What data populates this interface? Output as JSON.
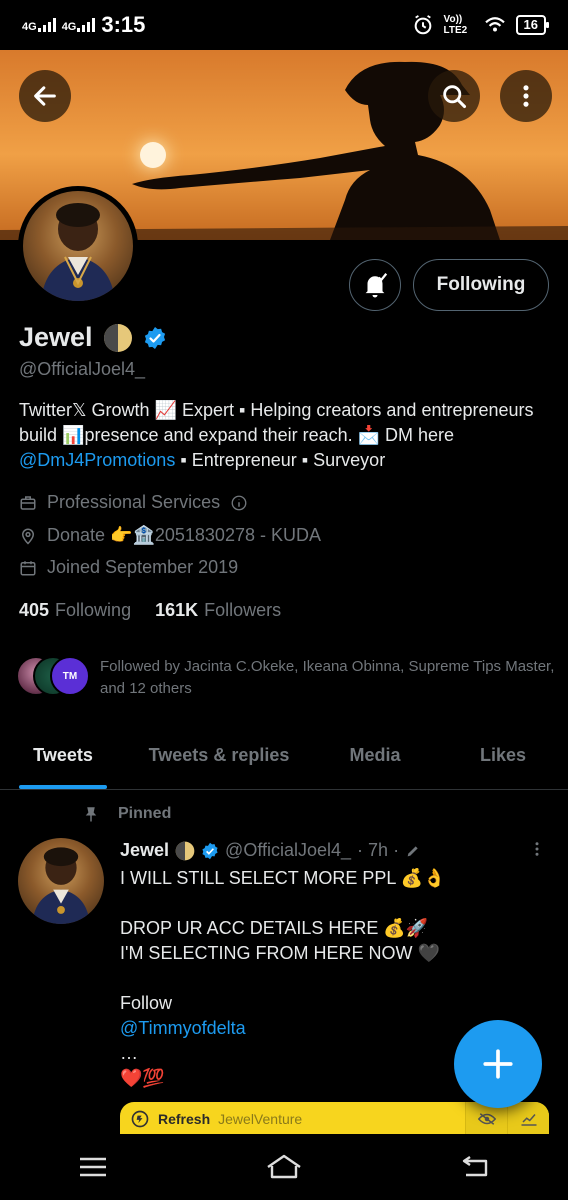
{
  "status_bar": {
    "network_1": "4G",
    "network_2": "4G",
    "time": "3:15",
    "volte_label": "Vo)) LTE2",
    "battery": "16"
  },
  "profile": {
    "display_name": "Jewel",
    "handle": "@OfficialJoel4_",
    "bio_part1": "Twitter𝕏 Growth 📈 Expert ▪ Helping creators and entrepreneurs build 📊presence and expand their reach. 📩 DM here ",
    "bio_link": "@DmJ4Promotions",
    "bio_part2": " ▪ Entrepreneur ▪ Surveyor",
    "category": "Professional Services",
    "location": "Donate 👉🏦2051830278 - KUDA",
    "joined": "Joined September 2019",
    "following_count": "405",
    "following_label": "Following",
    "followers_count": "161K",
    "followers_label": "Followers",
    "followed_by": "Followed by Jacinta C.Okeke, Ikeana Obinna, Supreme Tips Master, and 12 others",
    "following_button": "Following"
  },
  "tabs": [
    {
      "label": "Tweets",
      "active": true
    },
    {
      "label": "Tweets & replies",
      "active": false
    },
    {
      "label": "Media",
      "active": false
    },
    {
      "label": "Likes",
      "active": false
    }
  ],
  "pinned_tweet": {
    "pinned_label": "Pinned",
    "name": "Jewel",
    "handle": "@OfficialJoel4_",
    "time": "· 7h ·",
    "lines": [
      "I WILL STILL SELECT MORE PPL 💰👌",
      "",
      "DROP UR ACC DETAILS HERE 💰🚀",
      "I'M SELECTING FROM HERE NOW 🖤",
      "",
      "Follow"
    ],
    "mention": "@Timmyofdelta",
    "ellipsis": "…",
    "reaction": "❤️💯"
  },
  "ad_strip": {
    "refresh": "Refresh",
    "brand": "JewelVenture"
  },
  "colors": {
    "accent": "#1d9bf0",
    "secondary_text": "#71767b",
    "primary_text": "#e7e9ea",
    "ad_yellow": "#f7d51e"
  }
}
